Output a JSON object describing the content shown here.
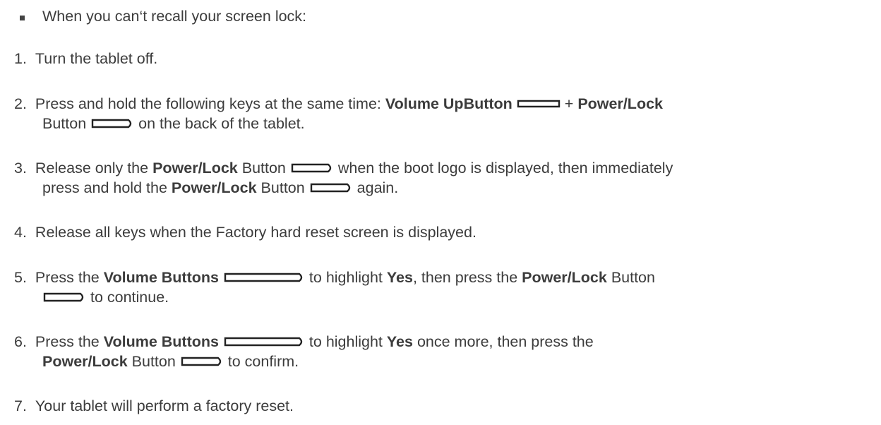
{
  "intro": {
    "text": "When you can‘t recall your screen lock:"
  },
  "steps": [
    {
      "number": "1.",
      "lines": [
        [
          "Turn the tablet off."
        ]
      ]
    },
    {
      "number": "2.",
      "parts": {
        "a": "Press and hold the following keys at the same time: ",
        "b": "Volume UpButton",
        "c": " + ",
        "d": "Power/Lock",
        "e": "Button",
        "f": " on the back of the tablet."
      }
    },
    {
      "number": "3.",
      "parts": {
        "a": "Release only the ",
        "b": "Power/Lock",
        "c": " Button ",
        "d": " when the boot logo is displayed, then immediately",
        "e": "press and hold the ",
        "f": "Power/Lock",
        "g": " Button ",
        "h": " again."
      }
    },
    {
      "number": "4.",
      "text": "Release all keys when the Factory hard reset screen is displayed."
    },
    {
      "number": "5.",
      "parts": {
        "a": "Press the ",
        "b": "Volume Buttons",
        "c": " to highlight ",
        "d": "Yes",
        "e": ", then press the ",
        "f": "Power/Lock",
        "g": " Button",
        "h": " to continue."
      }
    },
    {
      "number": "6.",
      "parts": {
        "a": "Press the ",
        "b": "Volume Buttons",
        "c": " to highlight ",
        "d": "Yes",
        "e": " once more, then press the",
        "f": "Power/Lock",
        "g": " Button ",
        "h": " to confirm."
      }
    },
    {
      "number": "7.",
      "text": "Your tablet will perform a factory reset."
    }
  ]
}
